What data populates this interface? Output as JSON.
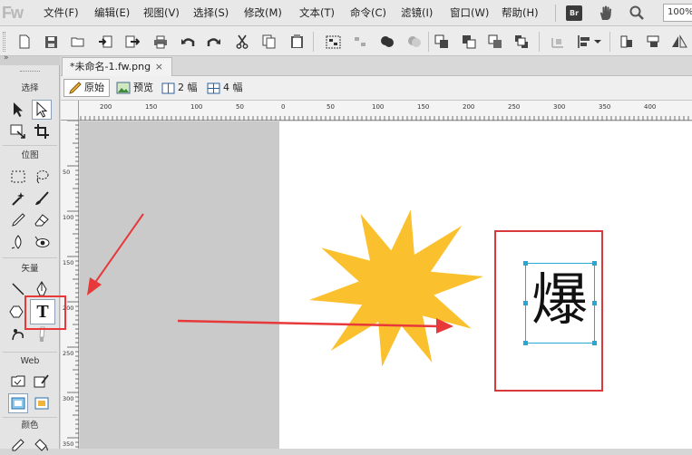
{
  "app": {
    "logo": "Fw"
  },
  "menu": [
    "文件(F)",
    "编辑(E)",
    "视图(V)",
    "选择(S)",
    "修改(M)",
    "文本(T)",
    "命令(C)",
    "滤镜(I)",
    "窗口(W)",
    "帮助(H)"
  ],
  "top_right": {
    "bridge_badge": "Br",
    "zoom_value": "100%"
  },
  "tools_panel": {
    "sections": [
      "选择",
      "位图",
      "矢量",
      "Web",
      "颜色"
    ],
    "text_tool_glyph": "T"
  },
  "document": {
    "tab_title": "*未命名-1.fw.png",
    "close_glyph": "×"
  },
  "view_buttons": [
    "原始",
    "预览",
    "2 幅",
    "4 幅"
  ],
  "h_ruler_labels": [
    "200",
    "150",
    "100",
    "50",
    "0",
    "50",
    "100",
    "150",
    "200",
    "250",
    "300",
    "350",
    "400"
  ],
  "v_ruler_labels": [
    "50",
    "100",
    "150",
    "200",
    "250",
    "300",
    "350"
  ],
  "canvas_text": {
    "character": "爆"
  },
  "colors": {
    "starburst": "#fbc02d",
    "annotation_red": "#e8393a",
    "selection_handle": "#29a7d6"
  }
}
